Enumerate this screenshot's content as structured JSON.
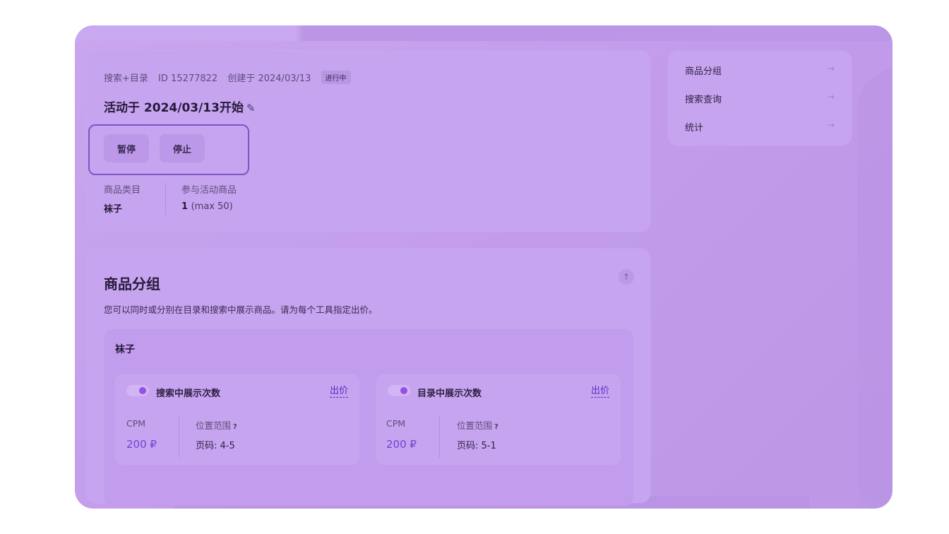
{
  "campaign": {
    "type": "搜索+目录",
    "id_label": "ID 15277822",
    "created_label": "创建于 2024/03/13",
    "status_badge": "进行中",
    "title": "活动于 2024/03/13开始",
    "edit_icon": "pencil-icon",
    "buttons": {
      "pause": "暂停",
      "stop": "停止"
    },
    "stats": {
      "category_label": "商品类目",
      "category_value": "袜子",
      "products_label": "参与活动商品",
      "products_value": "1",
      "products_max": "(max 50)"
    }
  },
  "side_nav": {
    "items": [
      {
        "label": "商品分组",
        "icon": "arrow-right-icon"
      },
      {
        "label": "搜索查询",
        "icon": "arrow-right-icon"
      },
      {
        "label": "统计",
        "icon": "arrow-right-icon"
      }
    ]
  },
  "groups": {
    "heading": "商品分组",
    "description": "您可以同时或分别在目录和搜索中展示商品。请为每个工具指定出价。",
    "collapse_icon": "arrow-up-icon",
    "group": {
      "name": "袜子",
      "search": {
        "toggle_on": true,
        "label": "搜索中展示次数",
        "bid_link": "出价",
        "cpm_label": "CPM",
        "cpm_value": "200 ₽",
        "position_label": "位置范围",
        "position_help": "?",
        "position_value": "页码: 4-5"
      },
      "catalog": {
        "toggle_on": true,
        "label": "目录中展示次数",
        "bid_link": "出价",
        "cpm_label": "CPM",
        "cpm_value": "200 ₽",
        "position_label": "位置范围",
        "position_help": "?",
        "position_value": "页码: 5-1"
      }
    }
  },
  "colors": {
    "accent": "#7342d4",
    "toggle_knob": "#9153e6",
    "focus_frame": "#7d55c8"
  }
}
